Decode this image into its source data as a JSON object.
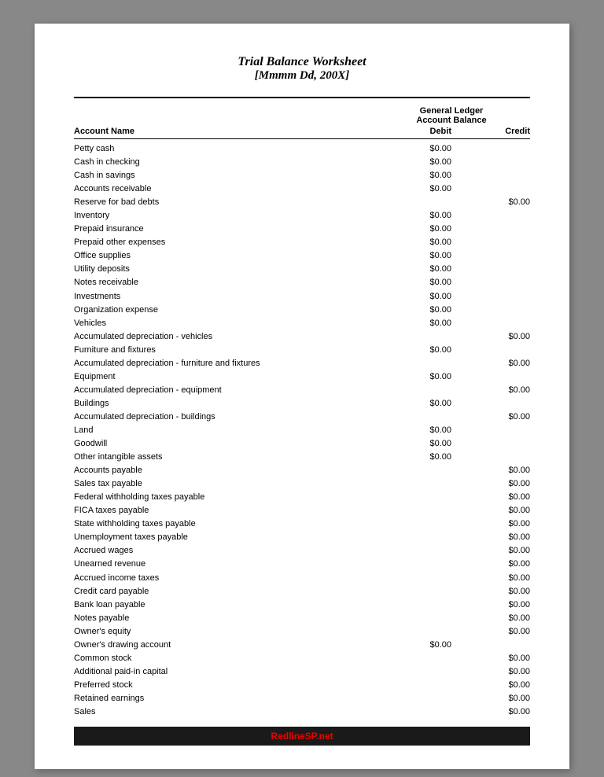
{
  "title": {
    "line1": "Trial Balance Worksheet",
    "line2": "[Mmmm Dd, 200X]"
  },
  "column_group_label": {
    "line1": "General Ledger",
    "line2": "Account Balance"
  },
  "headers": {
    "account_name": "Account Name",
    "debit": "Debit",
    "credit": "Credit"
  },
  "rows": [
    {
      "name": "Petty cash",
      "debit": "$0.00",
      "credit": ""
    },
    {
      "name": "Cash in checking",
      "debit": "$0.00",
      "credit": ""
    },
    {
      "name": "Cash in savings",
      "debit": "$0.00",
      "credit": ""
    },
    {
      "name": "Accounts receivable",
      "debit": "$0.00",
      "credit": ""
    },
    {
      "name": "Reserve for bad debts",
      "debit": "",
      "credit": "$0.00"
    },
    {
      "name": "Inventory",
      "debit": "$0.00",
      "credit": ""
    },
    {
      "name": "Prepaid insurance",
      "debit": "$0.00",
      "credit": ""
    },
    {
      "name": "Prepaid other expenses",
      "debit": "$0.00",
      "credit": ""
    },
    {
      "name": "Office supplies",
      "debit": "$0.00",
      "credit": ""
    },
    {
      "name": "Utility deposits",
      "debit": "$0.00",
      "credit": ""
    },
    {
      "name": "Notes receivable",
      "debit": "$0.00",
      "credit": ""
    },
    {
      "name": "Investments",
      "debit": "$0.00",
      "credit": ""
    },
    {
      "name": "Organization expense",
      "debit": "$0.00",
      "credit": ""
    },
    {
      "name": "Vehicles",
      "debit": "$0.00",
      "credit": ""
    },
    {
      "name": "Accumulated depreciation - vehicles",
      "debit": "",
      "credit": "$0.00"
    },
    {
      "name": "Furniture and fixtures",
      "debit": "$0.00",
      "credit": ""
    },
    {
      "name": "Accumulated depreciation - furniture and fixtures",
      "debit": "",
      "credit": "$0.00"
    },
    {
      "name": "Equipment",
      "debit": "$0.00",
      "credit": ""
    },
    {
      "name": "Accumulated depreciation - equipment",
      "debit": "",
      "credit": "$0.00"
    },
    {
      "name": "Buildings",
      "debit": "$0.00",
      "credit": ""
    },
    {
      "name": "Accumulated depreciation - buildings",
      "debit": "",
      "credit": "$0.00"
    },
    {
      "name": "Land",
      "debit": "$0.00",
      "credit": ""
    },
    {
      "name": "Goodwill",
      "debit": "$0.00",
      "credit": ""
    },
    {
      "name": "Other intangible assets",
      "debit": "$0.00",
      "credit": ""
    },
    {
      "name": "Accounts payable",
      "debit": "",
      "credit": "$0.00"
    },
    {
      "name": "Sales tax payable",
      "debit": "",
      "credit": "$0.00"
    },
    {
      "name": "Federal withholding taxes payable",
      "debit": "",
      "credit": "$0.00"
    },
    {
      "name": "FICA taxes payable",
      "debit": "",
      "credit": "$0.00"
    },
    {
      "name": "State withholding taxes payable",
      "debit": "",
      "credit": "$0.00"
    },
    {
      "name": "Unemployment taxes payable",
      "debit": "",
      "credit": "$0.00"
    },
    {
      "name": "Accrued wages",
      "debit": "",
      "credit": "$0.00"
    },
    {
      "name": "Unearned revenue",
      "debit": "",
      "credit": "$0.00"
    },
    {
      "name": "Accrued income taxes",
      "debit": "",
      "credit": "$0.00"
    },
    {
      "name": "Credit card payable",
      "debit": "",
      "credit": "$0.00"
    },
    {
      "name": "Bank loan payable",
      "debit": "",
      "credit": "$0.00"
    },
    {
      "name": "Notes payable",
      "debit": "",
      "credit": "$0.00"
    },
    {
      "name": "Owner's equity",
      "debit": "",
      "credit": "$0.00"
    },
    {
      "name": "Owner's drawing account",
      "debit": "$0.00",
      "credit": ""
    },
    {
      "name": "Common stock",
      "debit": "",
      "credit": "$0.00"
    },
    {
      "name": "Additional paid-in capital",
      "debit": "",
      "credit": "$0.00"
    },
    {
      "name": "Preferred stock",
      "debit": "",
      "credit": "$0.00"
    },
    {
      "name": "Retained earnings",
      "debit": "",
      "credit": "$0.00"
    },
    {
      "name": "Sales",
      "debit": "",
      "credit": "$0.00"
    }
  ],
  "footer": {
    "text": "RedlineSP.net",
    "brand": "Redline",
    "suffix": "SP.net"
  }
}
